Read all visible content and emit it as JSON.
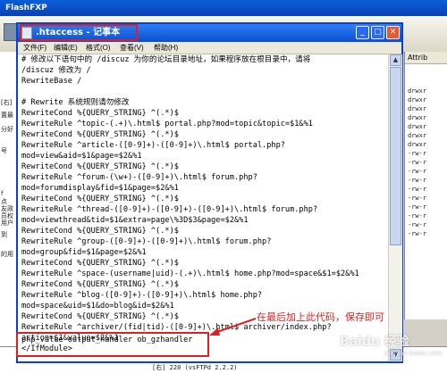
{
  "background_app": {
    "title": "FlashFXP",
    "left_panel_lines": [
      "[右]",
      "置最",
      "分好",
      "号",
      "f",
      "点",
      "友政",
      "员权",
      "用户",
      "到",
      "的用"
    ],
    "right_panel_header": "Attrib",
    "right_panel_rows": [
      "drwxr",
      "drwxr",
      "drwxr",
      "drwxr",
      "drwxr",
      "drwxr",
      "drwxr",
      "-rw-r",
      "-rw-r",
      "-rw-r",
      "-rw-r",
      "-rw-r",
      "-rw-r",
      "-rw-r",
      "-rw-r",
      "-rw-r",
      "-rw-r"
    ],
    "log_line": "[右] 220 (vsFTPd 2.2.2)"
  },
  "notepad": {
    "title": ".htaccess - 记事本",
    "menu": [
      "文件(F)",
      "编辑(E)",
      "格式(O)",
      "查看(V)",
      "帮助(H)"
    ],
    "lines": [
      "# 修改以下语句中的 /discuz 为你的论坛目录地址，如果程序放在根目录中，请将",
      "/discuz 修改为 /",
      "RewriteBase /",
      "",
      "# Rewrite 系统规则请勿修改",
      "RewriteCond %{QUERY_STRING} ^(.*)$",
      "RewriteRule ^topic-(.+)\\.html$ portal.php?mod=topic&topic=$1&%1",
      "RewriteCond %{QUERY_STRING} ^(.*)$",
      "RewriteRule ^article-([0-9]+)-([0-9]+)\\.html$ portal.php?",
      "mod=view&aid=$1&page=$2&%1",
      "RewriteCond %{QUERY_STRING} ^(.*)$",
      "RewriteRule ^forum-(\\w+)-([0-9]+)\\.html$ forum.php?",
      "mod=forumdisplay&fid=$1&page=$2&%1",
      "RewriteCond %{QUERY_STRING} ^(.*)$",
      "RewriteRule ^thread-([0-9]+)-([0-9]+)-([0-9]+)\\.html$ forum.php?",
      "mod=viewthread&tid=$1&extra=page\\%3D$3&page=$2&%1",
      "RewriteCond %{QUERY_STRING} ^(.*)$",
      "RewriteRule ^group-([0-9]+)-([0-9]+)\\.html$ forum.php?",
      "mod=group&fid=$1&page=$2&%1",
      "RewriteCond %{QUERY_STRING} ^(.*)$",
      "RewriteRule ^space-(username|uid)-(.+)\\.html$ home.php?mod=space&$1=$2&%1",
      "RewriteCond %{QUERY_STRING} ^(.*)$",
      "RewriteRule ^blog-([0-9]+)-([0-9]+)\\.html$ home.php?",
      "mod=space&uid=$1&do=blog&id=$2&%1",
      "RewriteCond %{QUERY_STRING} ^(.*)$",
      "RewriteRule ^archiver/(fid|tid)-([0-9]+)\\.html$ archiver/index.php?",
      "action=$1&value=$2&%1",
      "</IfModule>",
      "",
      "",
      "php_value output_handler ob_gzhandler"
    ]
  },
  "annotation": {
    "text": "在最后加上此代码，保存即可",
    "watermark": "Baidu 经验",
    "watermark_sub": "jingyan.baidu.com"
  },
  "colors": {
    "annotation_red": "#e02020",
    "xp_title_blue": "#0a4fd0"
  }
}
